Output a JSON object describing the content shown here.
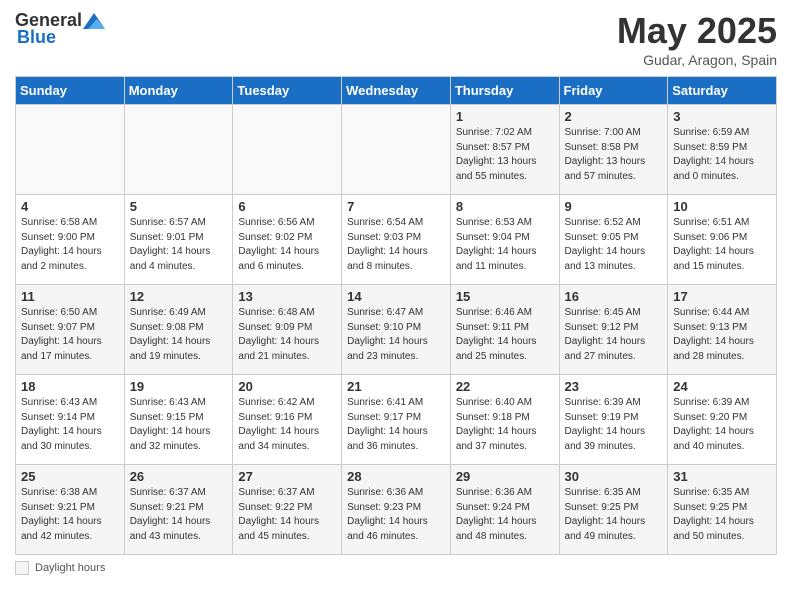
{
  "header": {
    "logo_general": "General",
    "logo_blue": "Blue",
    "title": "May 2025",
    "location": "Gudar, Aragon, Spain"
  },
  "weekdays": [
    "Sunday",
    "Monday",
    "Tuesday",
    "Wednesday",
    "Thursday",
    "Friday",
    "Saturday"
  ],
  "weeks": [
    [
      {
        "day": "",
        "details": ""
      },
      {
        "day": "",
        "details": ""
      },
      {
        "day": "",
        "details": ""
      },
      {
        "day": "",
        "details": ""
      },
      {
        "day": "1",
        "details": "Sunrise: 7:02 AM\nSunset: 8:57 PM\nDaylight: 13 hours\nand 55 minutes."
      },
      {
        "day": "2",
        "details": "Sunrise: 7:00 AM\nSunset: 8:58 PM\nDaylight: 13 hours\nand 57 minutes."
      },
      {
        "day": "3",
        "details": "Sunrise: 6:59 AM\nSunset: 8:59 PM\nDaylight: 14 hours\nand 0 minutes."
      }
    ],
    [
      {
        "day": "4",
        "details": "Sunrise: 6:58 AM\nSunset: 9:00 PM\nDaylight: 14 hours\nand 2 minutes."
      },
      {
        "day": "5",
        "details": "Sunrise: 6:57 AM\nSunset: 9:01 PM\nDaylight: 14 hours\nand 4 minutes."
      },
      {
        "day": "6",
        "details": "Sunrise: 6:56 AM\nSunset: 9:02 PM\nDaylight: 14 hours\nand 6 minutes."
      },
      {
        "day": "7",
        "details": "Sunrise: 6:54 AM\nSunset: 9:03 PM\nDaylight: 14 hours\nand 8 minutes."
      },
      {
        "day": "8",
        "details": "Sunrise: 6:53 AM\nSunset: 9:04 PM\nDaylight: 14 hours\nand 11 minutes."
      },
      {
        "day": "9",
        "details": "Sunrise: 6:52 AM\nSunset: 9:05 PM\nDaylight: 14 hours\nand 13 minutes."
      },
      {
        "day": "10",
        "details": "Sunrise: 6:51 AM\nSunset: 9:06 PM\nDaylight: 14 hours\nand 15 minutes."
      }
    ],
    [
      {
        "day": "11",
        "details": "Sunrise: 6:50 AM\nSunset: 9:07 PM\nDaylight: 14 hours\nand 17 minutes."
      },
      {
        "day": "12",
        "details": "Sunrise: 6:49 AM\nSunset: 9:08 PM\nDaylight: 14 hours\nand 19 minutes."
      },
      {
        "day": "13",
        "details": "Sunrise: 6:48 AM\nSunset: 9:09 PM\nDaylight: 14 hours\nand 21 minutes."
      },
      {
        "day": "14",
        "details": "Sunrise: 6:47 AM\nSunset: 9:10 PM\nDaylight: 14 hours\nand 23 minutes."
      },
      {
        "day": "15",
        "details": "Sunrise: 6:46 AM\nSunset: 9:11 PM\nDaylight: 14 hours\nand 25 minutes."
      },
      {
        "day": "16",
        "details": "Sunrise: 6:45 AM\nSunset: 9:12 PM\nDaylight: 14 hours\nand 27 minutes."
      },
      {
        "day": "17",
        "details": "Sunrise: 6:44 AM\nSunset: 9:13 PM\nDaylight: 14 hours\nand 28 minutes."
      }
    ],
    [
      {
        "day": "18",
        "details": "Sunrise: 6:43 AM\nSunset: 9:14 PM\nDaylight: 14 hours\nand 30 minutes."
      },
      {
        "day": "19",
        "details": "Sunrise: 6:43 AM\nSunset: 9:15 PM\nDaylight: 14 hours\nand 32 minutes."
      },
      {
        "day": "20",
        "details": "Sunrise: 6:42 AM\nSunset: 9:16 PM\nDaylight: 14 hours\nand 34 minutes."
      },
      {
        "day": "21",
        "details": "Sunrise: 6:41 AM\nSunset: 9:17 PM\nDaylight: 14 hours\nand 36 minutes."
      },
      {
        "day": "22",
        "details": "Sunrise: 6:40 AM\nSunset: 9:18 PM\nDaylight: 14 hours\nand 37 minutes."
      },
      {
        "day": "23",
        "details": "Sunrise: 6:39 AM\nSunset: 9:19 PM\nDaylight: 14 hours\nand 39 minutes."
      },
      {
        "day": "24",
        "details": "Sunrise: 6:39 AM\nSunset: 9:20 PM\nDaylight: 14 hours\nand 40 minutes."
      }
    ],
    [
      {
        "day": "25",
        "details": "Sunrise: 6:38 AM\nSunset: 9:21 PM\nDaylight: 14 hours\nand 42 minutes."
      },
      {
        "day": "26",
        "details": "Sunrise: 6:37 AM\nSunset: 9:21 PM\nDaylight: 14 hours\nand 43 minutes."
      },
      {
        "day": "27",
        "details": "Sunrise: 6:37 AM\nSunset: 9:22 PM\nDaylight: 14 hours\nand 45 minutes."
      },
      {
        "day": "28",
        "details": "Sunrise: 6:36 AM\nSunset: 9:23 PM\nDaylight: 14 hours\nand 46 minutes."
      },
      {
        "day": "29",
        "details": "Sunrise: 6:36 AM\nSunset: 9:24 PM\nDaylight: 14 hours\nand 48 minutes."
      },
      {
        "day": "30",
        "details": "Sunrise: 6:35 AM\nSunset: 9:25 PM\nDaylight: 14 hours\nand 49 minutes."
      },
      {
        "day": "31",
        "details": "Sunrise: 6:35 AM\nSunset: 9:25 PM\nDaylight: 14 hours\nand 50 minutes."
      }
    ]
  ],
  "footer": {
    "legend": "Daylight hours"
  }
}
